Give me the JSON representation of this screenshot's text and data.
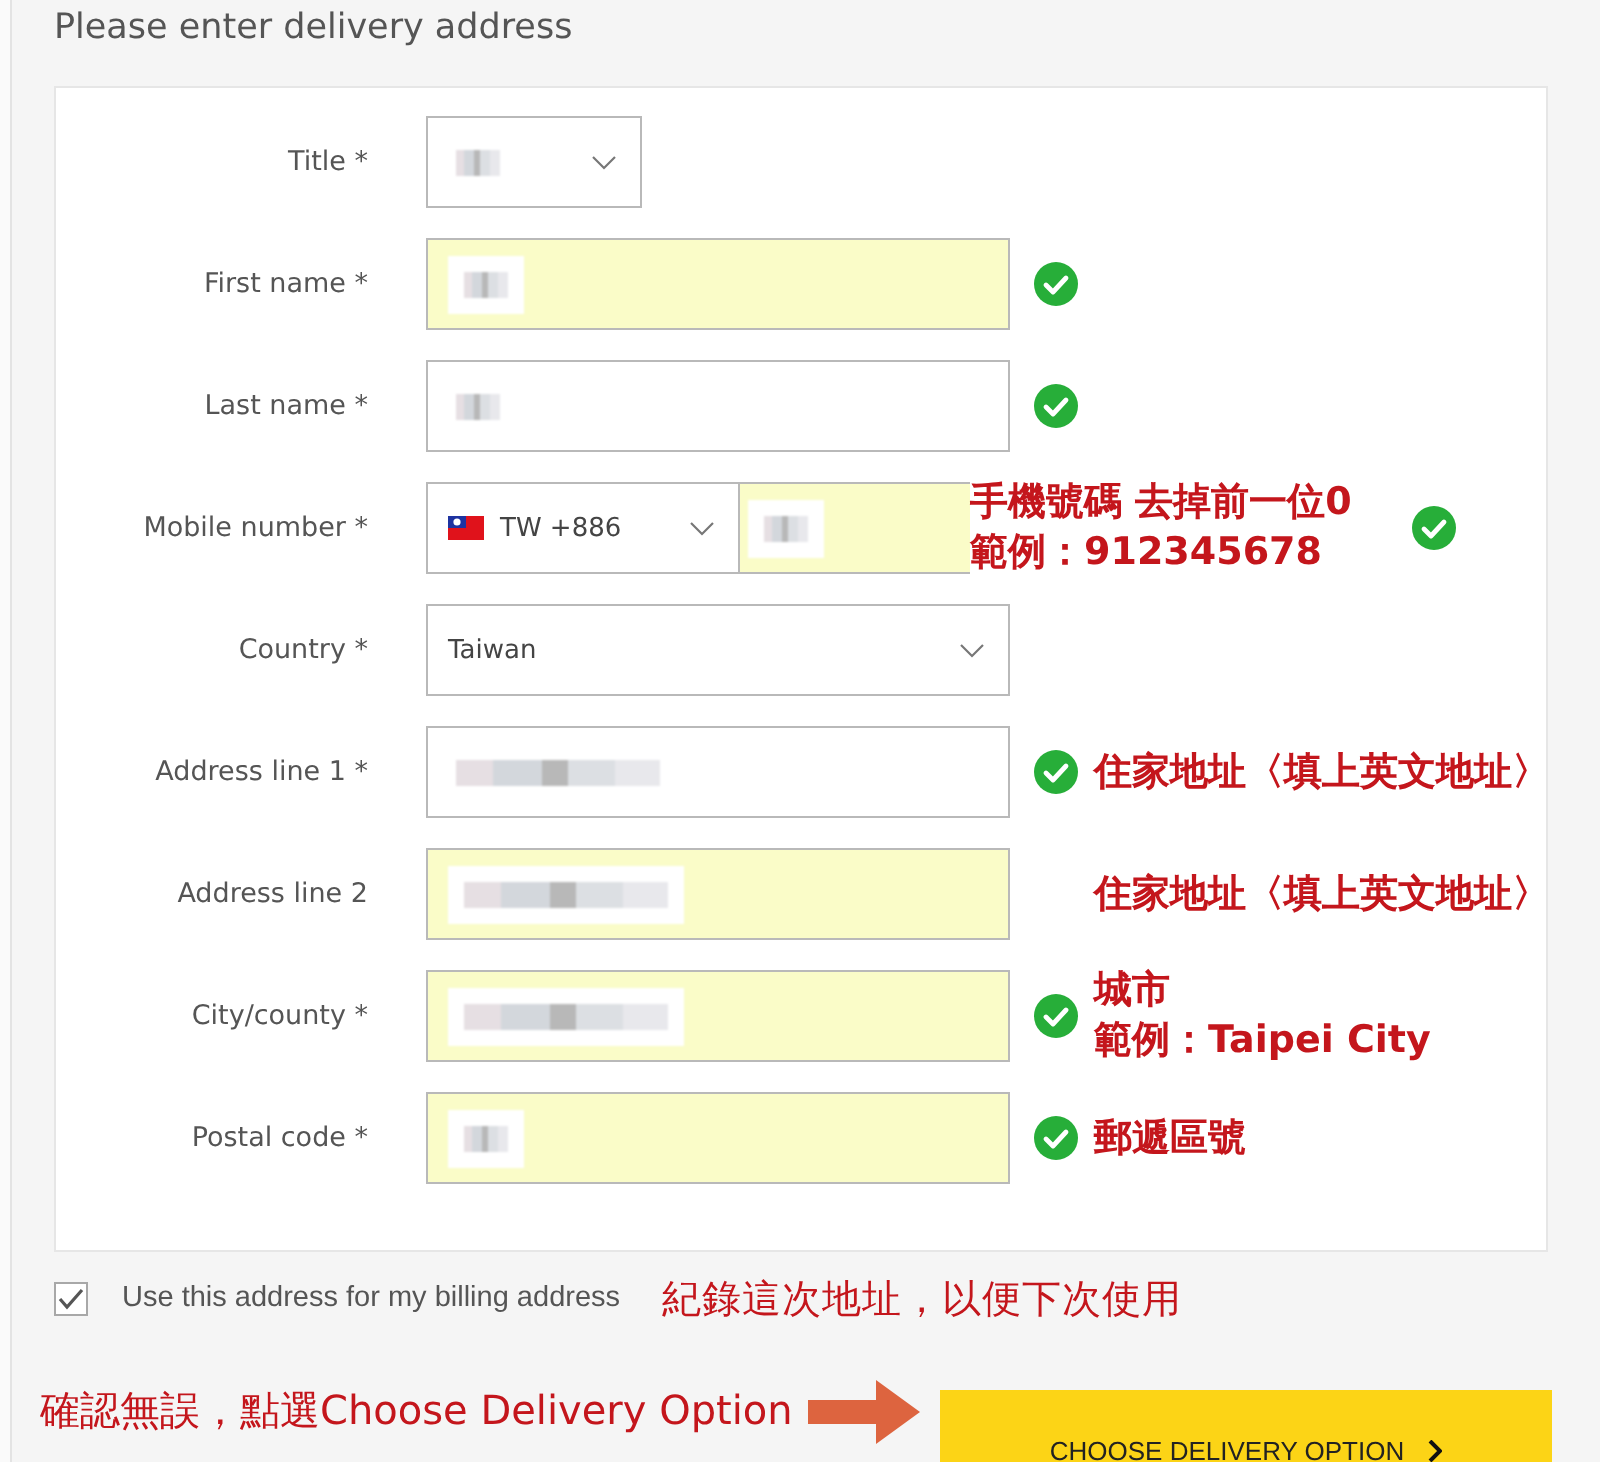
{
  "heading": "Please enter delivery address",
  "fields": [
    {
      "kind": "short-select",
      "label": "Title *",
      "redacted": true,
      "autofilled": false,
      "valid": false
    },
    {
      "kind": "text",
      "label": "First name *",
      "redacted": true,
      "autofilled": true,
      "valid": true
    },
    {
      "kind": "text",
      "label": "Last name *",
      "redacted": true,
      "autofilled": false,
      "valid": true
    },
    {
      "kind": "phone",
      "label": "Mobile number *",
      "country_code": "TW +886",
      "redacted": true,
      "autofilled": true,
      "valid": true,
      "hint": [
        "手機號碼 去掉前一位0",
        "範例：912345678"
      ]
    },
    {
      "kind": "select",
      "label": "Country *",
      "value": "Taiwan",
      "autofilled": false,
      "valid": false
    },
    {
      "kind": "address",
      "label": "Address line 1 *",
      "redacted": true,
      "autofilled": false,
      "valid": true,
      "hint": [
        "住家地址〈填上英文地址〉"
      ]
    },
    {
      "kind": "address",
      "label": "Address line 2",
      "redacted": true,
      "autofilled": true,
      "valid": false,
      "hint": [
        "住家地址〈填上英文地址〉"
      ]
    },
    {
      "kind": "address",
      "label": "City/county *",
      "redacted": true,
      "autofilled": true,
      "valid": true,
      "hint": [
        "城市",
        "範例：Taipei City"
      ]
    },
    {
      "kind": "text",
      "label": "Postal code *",
      "redacted": true,
      "autofilled": true,
      "valid": true,
      "hint": [
        "郵遞區號"
      ]
    }
  ],
  "billing": {
    "label": "Use this address for my billing address",
    "checked": true,
    "hint": "紀錄這次地址，以便下次使用"
  },
  "footer": {
    "instruction": "確認無誤，點選Choose Delivery Option",
    "button": "CHOOSE DELIVERY OPTION"
  }
}
